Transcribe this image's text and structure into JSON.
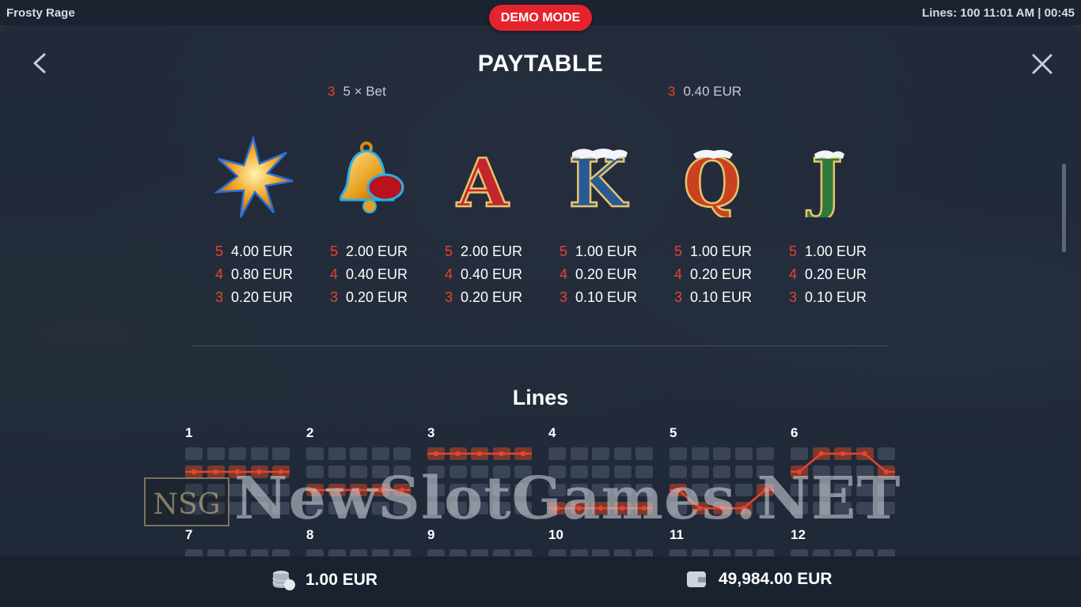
{
  "window": {
    "game_title": "Frosty Rage",
    "status": "Lines: 100  11:01 AM | 00:45"
  },
  "demo_badge": "DEMO MODE",
  "paytable": {
    "title": "PAYTABLE",
    "cutoff_left": {
      "count": "3",
      "text": "5 × Bet"
    },
    "cutoff_right": {
      "count": "3",
      "text": "0.40 EUR"
    },
    "symbols": [
      {
        "name": "star",
        "icon": "star-symbol-icon",
        "pays": [
          {
            "count": "5",
            "value": "4.00 EUR"
          },
          {
            "count": "4",
            "value": "0.80 EUR"
          },
          {
            "count": "3",
            "value": "0.20 EUR"
          }
        ]
      },
      {
        "name": "bell",
        "icon": "bell-symbol-icon",
        "pays": [
          {
            "count": "5",
            "value": "2.00 EUR"
          },
          {
            "count": "4",
            "value": "0.40 EUR"
          },
          {
            "count": "3",
            "value": "0.20 EUR"
          }
        ]
      },
      {
        "name": "A",
        "icon": "letter-a-symbol-icon",
        "letter": "A",
        "color": "#c1272d",
        "pays": [
          {
            "count": "5",
            "value": "2.00 EUR"
          },
          {
            "count": "4",
            "value": "0.40 EUR"
          },
          {
            "count": "3",
            "value": "0.20 EUR"
          }
        ]
      },
      {
        "name": "K",
        "icon": "letter-k-symbol-icon",
        "letter": "K",
        "color": "#2a5a96",
        "pays": [
          {
            "count": "5",
            "value": "1.00 EUR"
          },
          {
            "count": "4",
            "value": "0.20 EUR"
          },
          {
            "count": "3",
            "value": "0.10 EUR"
          }
        ]
      },
      {
        "name": "Q",
        "icon": "letter-q-symbol-icon",
        "letter": "Q",
        "color": "#c9421f",
        "pays": [
          {
            "count": "5",
            "value": "1.00 EUR"
          },
          {
            "count": "4",
            "value": "0.20 EUR"
          },
          {
            "count": "3",
            "value": "0.10 EUR"
          }
        ]
      },
      {
        "name": "J",
        "icon": "letter-j-symbol-icon",
        "letter": "J",
        "color": "#2f7a3a",
        "pays": [
          {
            "count": "5",
            "value": "1.00 EUR"
          },
          {
            "count": "4",
            "value": "0.20 EUR"
          },
          {
            "count": "3",
            "value": "0.10 EUR"
          }
        ]
      }
    ]
  },
  "lines": {
    "title": "Lines",
    "items": [
      {
        "number": "1",
        "rows": [
          1,
          1,
          1,
          1,
          1
        ]
      },
      {
        "number": "2",
        "rows": [
          2,
          2,
          2,
          2,
          2
        ]
      },
      {
        "number": "3",
        "rows": [
          0,
          0,
          0,
          0,
          0
        ]
      },
      {
        "number": "4",
        "rows": [
          3,
          3,
          3,
          3,
          3
        ]
      },
      {
        "number": "5",
        "rows": [
          2,
          3,
          3,
          3,
          2
        ]
      },
      {
        "number": "6",
        "rows": [
          1,
          0,
          0,
          0,
          1
        ]
      },
      {
        "number": "7"
      },
      {
        "number": "8"
      },
      {
        "number": "9"
      },
      {
        "number": "10"
      },
      {
        "number": "11"
      },
      {
        "number": "12"
      }
    ]
  },
  "footer": {
    "bet": "1.00 EUR",
    "balance": "49,984.00 EUR"
  },
  "watermark": {
    "logo": "NSG",
    "text": "NewSlotGames.NET"
  },
  "colors": {
    "accent_red": "#e5232c",
    "payout_count": "#e8432c",
    "line_red": "#e8432c"
  }
}
